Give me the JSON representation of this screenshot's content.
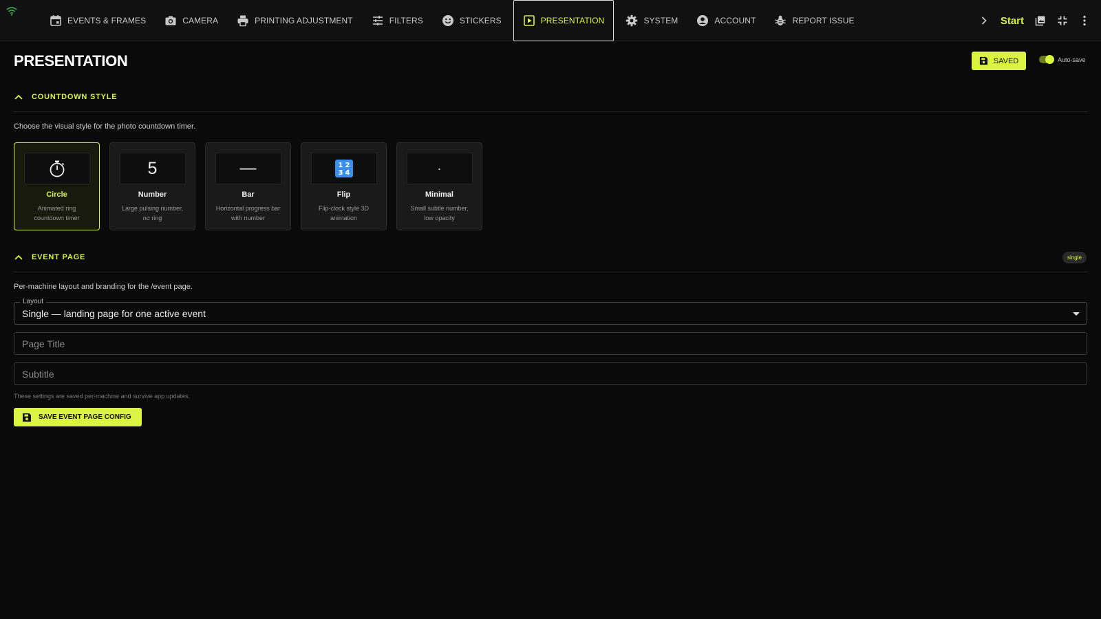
{
  "nav": {
    "tabs": [
      {
        "label": "EVENTS & FRAMES",
        "icon": "calendar-icon"
      },
      {
        "label": "CAMERA",
        "icon": "camera-icon"
      },
      {
        "label": "PRINTING ADJUSTMENT",
        "icon": "printer-icon"
      },
      {
        "label": "FILTERS",
        "icon": "sliders-icon"
      },
      {
        "label": "STICKERS",
        "icon": "smiley-icon"
      },
      {
        "label": "PRESENTATION",
        "icon": "play-square-icon",
        "active": true
      },
      {
        "label": "SYSTEM",
        "icon": "gear-icon"
      },
      {
        "label": "ACCOUNT",
        "icon": "account-icon"
      },
      {
        "label": "REPORT ISSUE",
        "icon": "bug-icon"
      }
    ],
    "start_label": "Start"
  },
  "page": {
    "title": "PRESENTATION",
    "saved_label": "SAVED",
    "autosave_label": "Auto-save",
    "autosave_on": true
  },
  "countdown": {
    "heading": "COUNTDOWN STYLE",
    "description": "Choose the visual style for the photo countdown timer.",
    "selected": "Circle",
    "options": [
      {
        "name": "Circle",
        "preview": "⏱",
        "description": "Animated ring countdown timer"
      },
      {
        "name": "Number",
        "preview": "5",
        "description": "Large pulsing number, no ring"
      },
      {
        "name": "Bar",
        "preview": "—",
        "description": "Horizontal progress bar with number"
      },
      {
        "name": "Flip",
        "preview": "🔢",
        "description": "Flip-clock style 3D animation"
      },
      {
        "name": "Minimal",
        "preview": "·",
        "description": "Small subtle number, low opacity"
      }
    ]
  },
  "event_page": {
    "heading": "EVENT PAGE",
    "badge": "single",
    "description": "Per-machine layout and branding for the /event page.",
    "layout_label": "Layout",
    "layout_value": "Single — landing page for one active event",
    "page_title_placeholder": "Page Title",
    "page_title_value": "",
    "subtitle_placeholder": "Subtitle",
    "subtitle_value": "",
    "helper": "These settings are saved per-machine and survive app updates.",
    "save_label": "SAVE EVENT PAGE CONFIG"
  },
  "colors": {
    "accent": "#d9f542",
    "background": "#0a0a0a",
    "card": "#1a1a1a"
  }
}
